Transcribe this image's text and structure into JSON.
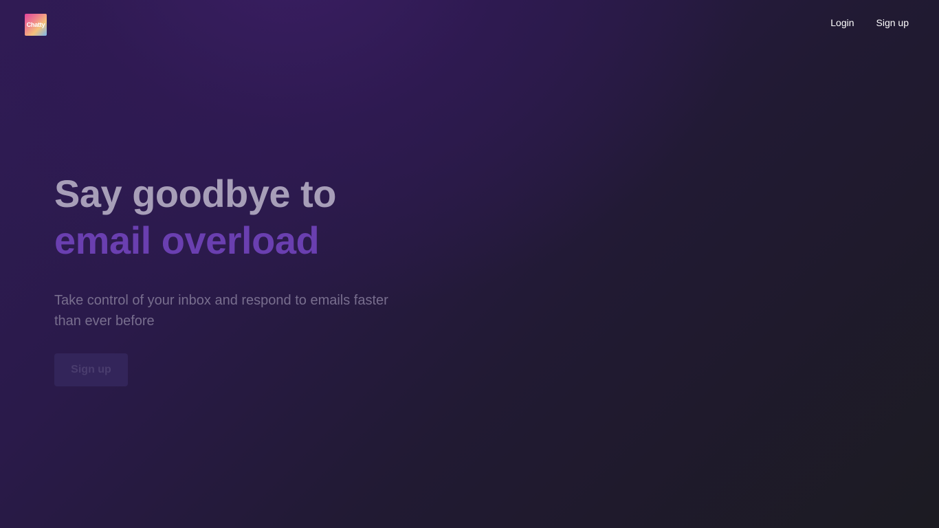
{
  "header": {
    "logo_text": "Chatty",
    "nav": {
      "login_label": "Login",
      "signup_label": "Sign up"
    }
  },
  "hero": {
    "headline_line1": "Say goodbye to",
    "headline_line2": "email overload",
    "subtext": "Take control of your inbox and respond to emails faster than ever before",
    "cta_label": "Sign up"
  },
  "colors": {
    "headline_primary": "#a79eb8",
    "headline_accent": "#6a3fb0",
    "subtext": "#786e8e",
    "cta_background": "#33255a",
    "background_start": "#2f1c55",
    "background_end": "#1c1b22"
  }
}
